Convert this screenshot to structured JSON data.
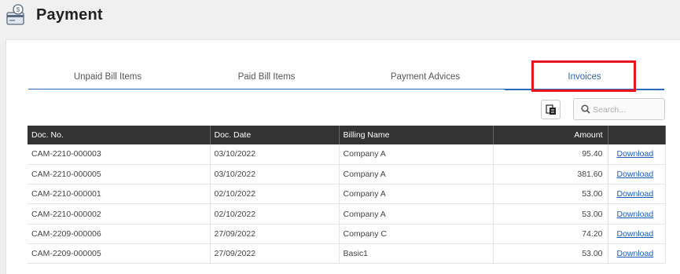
{
  "page": {
    "title": "Payment"
  },
  "tabs": [
    {
      "label": "Unpaid Bill Items",
      "active": false
    },
    {
      "label": "Paid Bill Items",
      "active": false
    },
    {
      "label": "Payment Advices",
      "active": false
    },
    {
      "label": "Invoices",
      "active": true
    }
  ],
  "toolbar": {
    "export_icon": "export-excel-icon",
    "search_placeholder": "Search..."
  },
  "table": {
    "headers": {
      "doc_no": "Doc. No.",
      "doc_date": "Doc. Date",
      "billing_name": "Billing Name",
      "amount": "Amount",
      "action": ""
    },
    "rows": [
      {
        "doc_no": "CAM-2210-000003",
        "doc_date": "03/10/2022",
        "billing_name": "Company A",
        "amount": "95.40",
        "action": "Download"
      },
      {
        "doc_no": "CAM-2210-000005",
        "doc_date": "03/10/2022",
        "billing_name": "Company A",
        "amount": "381.60",
        "action": "Download"
      },
      {
        "doc_no": "CAM-2210-000001",
        "doc_date": "02/10/2022",
        "billing_name": "Company A",
        "amount": "53.00",
        "action": "Download"
      },
      {
        "doc_no": "CAM-2210-000002",
        "doc_date": "02/10/2022",
        "billing_name": "Company A",
        "amount": "53.00",
        "action": "Download"
      },
      {
        "doc_no": "CAM-2209-000006",
        "doc_date": "27/09/2022",
        "billing_name": "Company C",
        "amount": "74.20",
        "action": "Download"
      },
      {
        "doc_no": "CAM-2209-000005",
        "doc_date": "27/09/2022",
        "billing_name": "Basic1",
        "amount": "53.00",
        "action": "Download"
      }
    ]
  },
  "colors": {
    "accent": "#2a6ab8",
    "highlight": "#e8141e",
    "header_bg": "#333333",
    "link": "#1d5bb6"
  }
}
